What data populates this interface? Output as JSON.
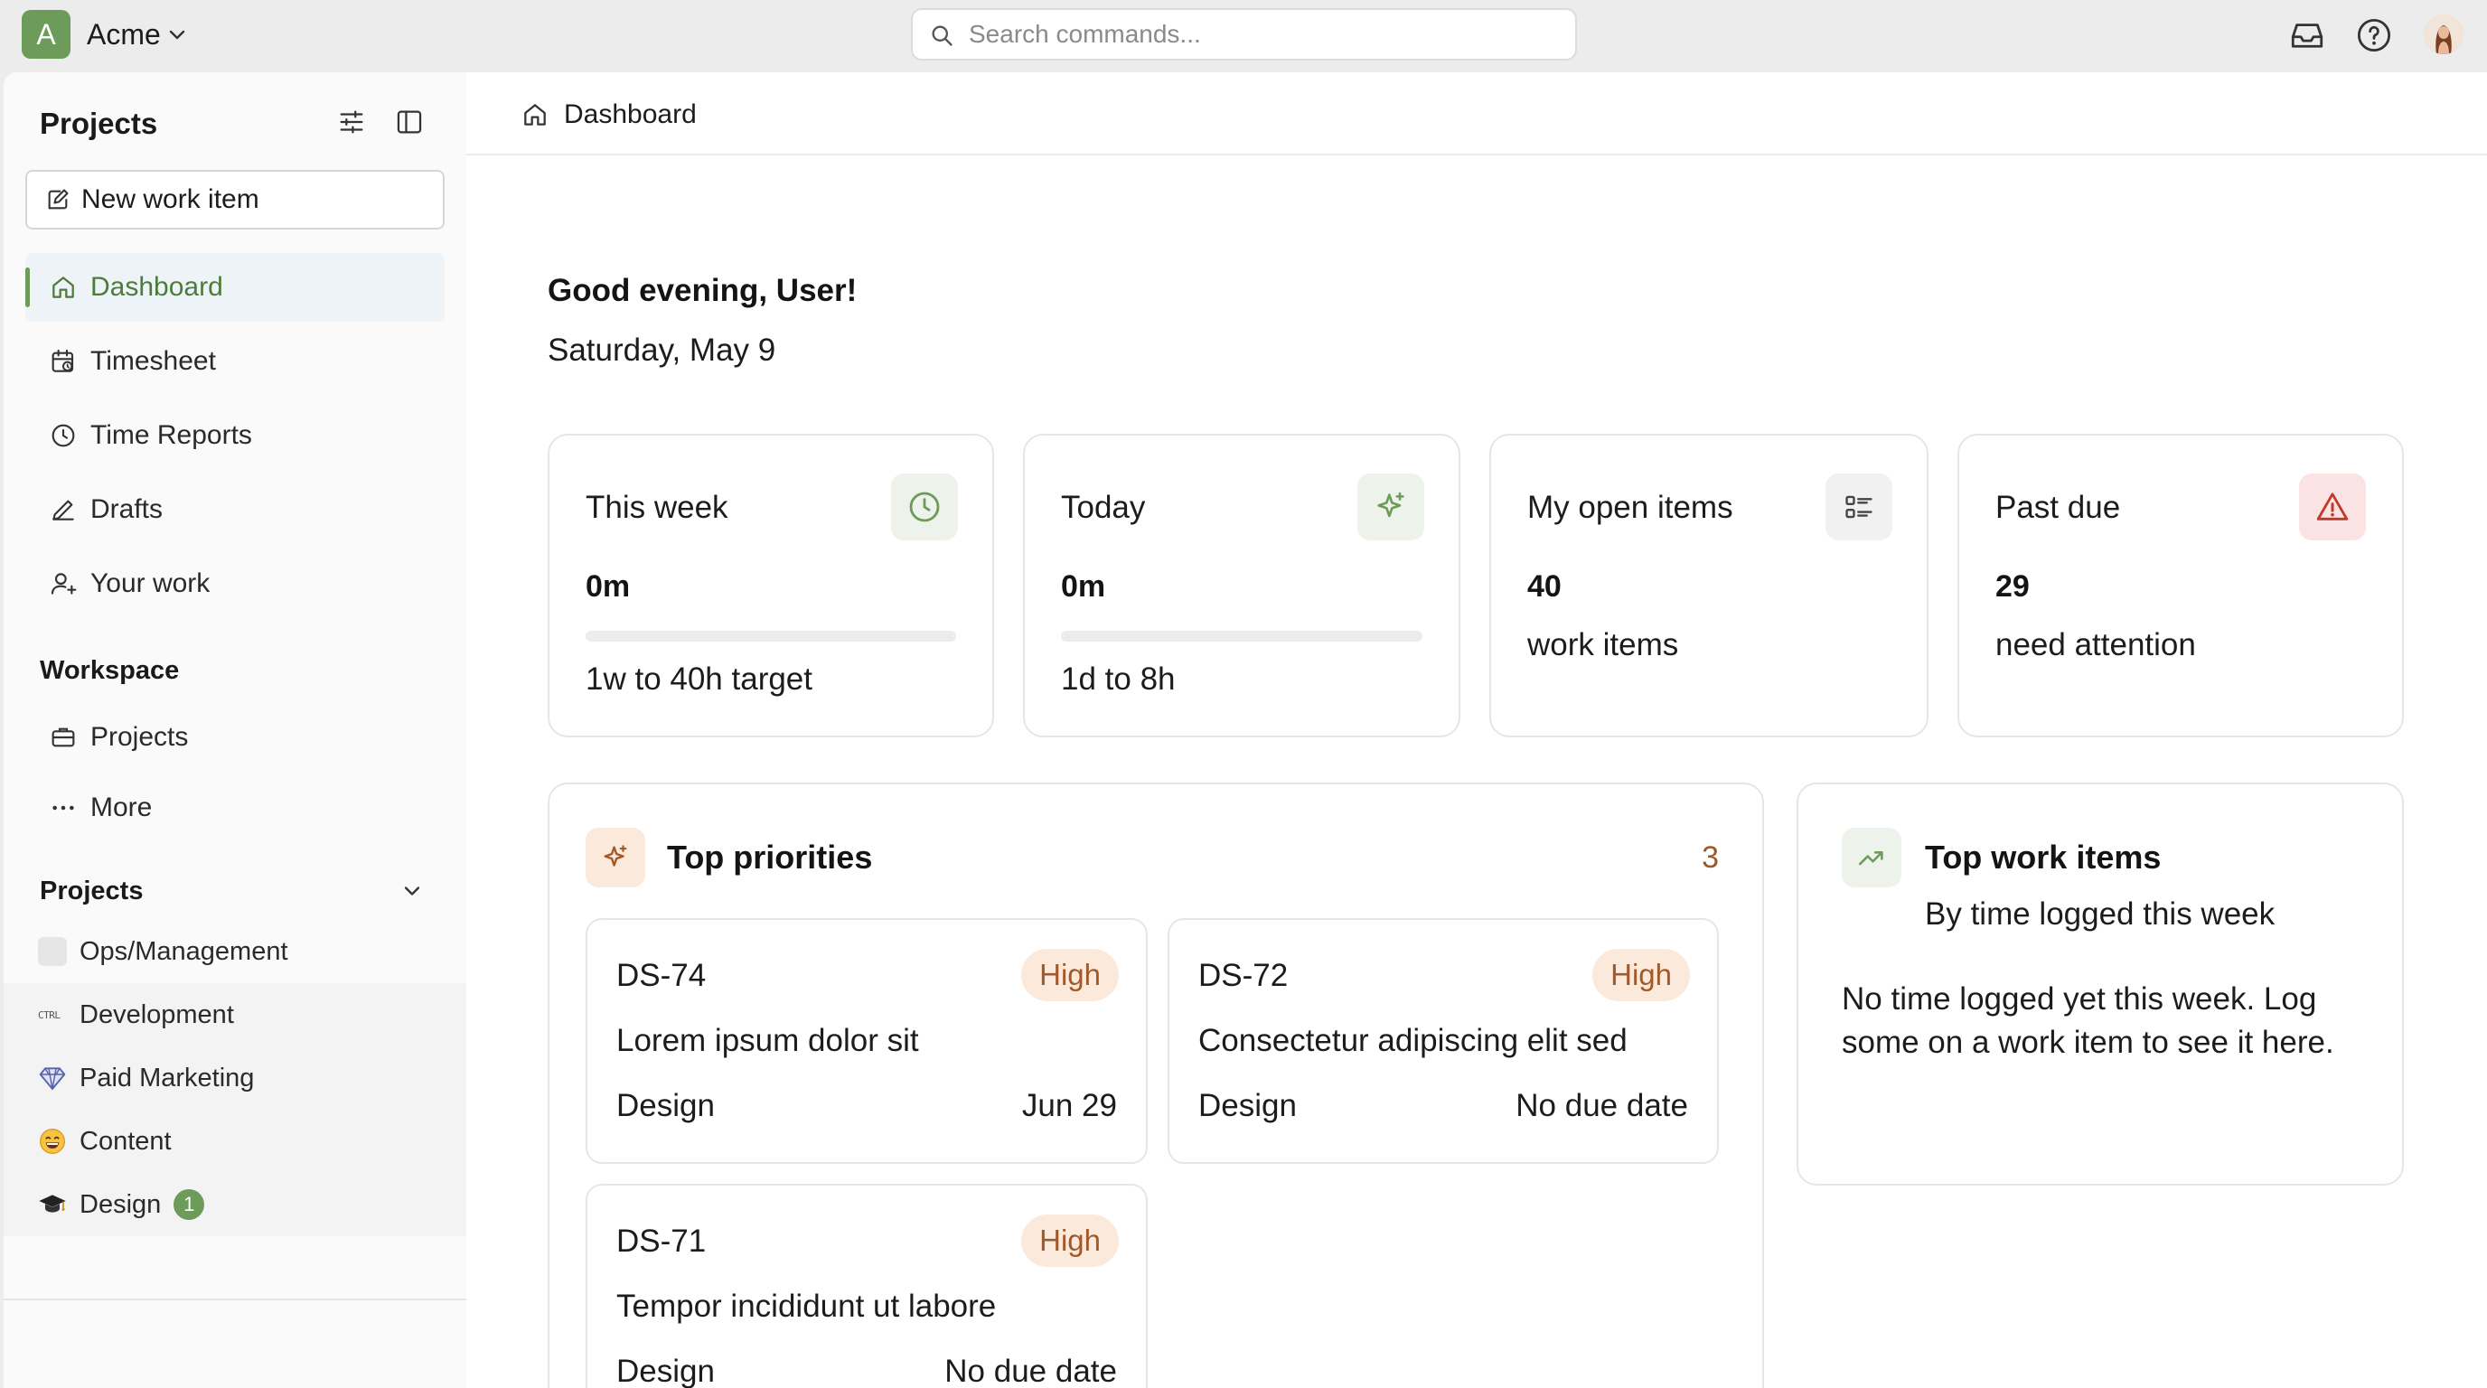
{
  "workspace": {
    "initial": "A",
    "name": "Acme"
  },
  "search": {
    "placeholder": "Search commands..."
  },
  "sidebar": {
    "title": "Projects",
    "new_item_label": "New work item",
    "nav": [
      {
        "label": "Dashboard",
        "icon": "home-icon",
        "active": true
      },
      {
        "label": "Timesheet",
        "icon": "calendar-clock-icon"
      },
      {
        "label": "Time Reports",
        "icon": "clock-icon"
      },
      {
        "label": "Drafts",
        "icon": "pencil-icon"
      },
      {
        "label": "Your work",
        "icon": "user-check-icon"
      }
    ],
    "workspace_section": "Workspace",
    "workspace_items": [
      {
        "label": "Projects",
        "icon": "briefcase-icon"
      },
      {
        "label": "More",
        "icon": "more-icon"
      }
    ],
    "projects_section": "Projects",
    "projects": [
      {
        "label": "Ops/Management",
        "icon": "blank-square-icon"
      },
      {
        "label": "Development",
        "icon": "ctrl-text-icon",
        "icon_text": "CTRL"
      },
      {
        "label": "Paid Marketing",
        "icon": "gem-icon"
      },
      {
        "label": "Content",
        "icon": "grinning-face-icon"
      },
      {
        "label": "Design",
        "icon": "graduation-cap-icon",
        "badge": "1"
      }
    ]
  },
  "breadcrumb": {
    "label": "Dashboard"
  },
  "greeting": "Good evening, User!",
  "date": "Saturday, May 9",
  "stats": {
    "this_week": {
      "label": "This week",
      "value": "0m",
      "sub": "1w to 40h target",
      "progress": 0
    },
    "today": {
      "label": "Today",
      "value": "0m",
      "sub": "1d to 8h",
      "progress": 0
    },
    "open_items": {
      "label": "My open items",
      "value": "40",
      "sub": "work items"
    },
    "past_due": {
      "label": "Past due",
      "value": "29",
      "sub": "need attention"
    }
  },
  "top_priorities": {
    "title": "Top priorities",
    "count": "3",
    "items": [
      {
        "id": "DS-74",
        "priority": "High",
        "title": "Lorem ipsum dolor sit",
        "category": "Design",
        "due": "Jun 29"
      },
      {
        "id": "DS-72",
        "priority": "High",
        "title": "Consectetur adipiscing elit sed",
        "category": "Design",
        "due": "No due date"
      },
      {
        "id": "DS-71",
        "priority": "High",
        "title": "Tempor incididunt ut labore",
        "category": "Design",
        "due": "No due date"
      }
    ]
  },
  "top_work_items": {
    "title": "Top work items",
    "subtitle": "By time logged this week",
    "empty": "No time logged yet this week. Log some on a work item to see it here."
  },
  "colors": {
    "accent": "#6c9b5a",
    "accent_light": "#edf3ea",
    "priority_bg": "#fbeadb",
    "priority_text": "#a2592a",
    "danger_bg": "#fbe3e3",
    "danger": "#c0392b"
  }
}
